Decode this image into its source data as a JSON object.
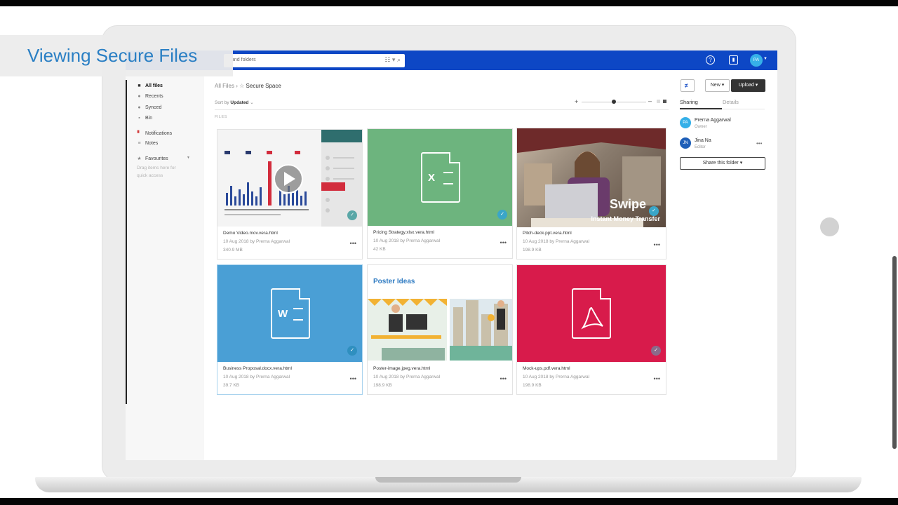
{
  "overlay_title": "Viewing Secure Files",
  "search": {
    "placeholder": "and folders"
  },
  "user_initials": "PA",
  "sidebar": {
    "items": [
      {
        "label": "All files",
        "icon": "folder-icon"
      },
      {
        "label": "Recents",
        "icon": "clock-icon"
      },
      {
        "label": "Synced",
        "icon": "sync-icon"
      },
      {
        "label": "Bin",
        "icon": "bin-icon"
      },
      {
        "label": "Notifications",
        "icon": "bell-icon"
      },
      {
        "label": "Notes",
        "icon": "notes-icon"
      },
      {
        "label": "Favourites",
        "icon": "star-icon"
      }
    ],
    "favourites_hint_1": "Drag items here for",
    "favourites_hint_2": "quick access"
  },
  "breadcrumb": {
    "root": "All Files",
    "current": "Secure Space"
  },
  "sort": {
    "label": "Sort by",
    "value": "Updated"
  },
  "files_label": "FILES",
  "toolbar": {
    "new_label": "New",
    "upload_label": "Upload"
  },
  "files": [
    {
      "name": "Demo Video.mov.vera.html",
      "meta": "10 Aug 2018 by Prerna Aggarwal",
      "size": "340.9 MB"
    },
    {
      "name": "Pricing Strategy.xlsx.vera.html",
      "meta": "10 Aug 2018 by Prerna Aggarwal",
      "size": "42 KB"
    },
    {
      "name": "Pitch-deck.ppt.vera.html",
      "meta": "10 Aug 2018 by Prerna Aggarwal",
      "size": "198.9 KB"
    },
    {
      "name": "Business Proposal.docx.vera.html",
      "meta": "10 Aug 2018 by Prerna Aggarwal",
      "size": "39.7 KB"
    },
    {
      "name": "Poster-image.jpeg.vera.html",
      "meta": "10 Aug 2018 by Prerna Aggarwal",
      "size": "198.9 KB"
    },
    {
      "name": "Mock-ups.pdf.vera.html",
      "meta": "10 Aug 2018 by Prerna Aggarwal",
      "size": "198.9 KB"
    }
  ],
  "thumb_text": {
    "excel_letter": "X",
    "word_letter": "W",
    "swipe_title": "Swipe",
    "swipe_sub": "Instant Money Transfer",
    "poster_title": "Poster Ideas"
  },
  "right_panel": {
    "tabs": [
      "Sharing",
      "Details"
    ],
    "users": [
      {
        "initials": "PA",
        "name": "Prerna Aggarwal",
        "role": "Owner",
        "color": "#36b0e8"
      },
      {
        "initials": "JN",
        "name": "Jina Na",
        "role": "Editor",
        "color": "#1f5fb8"
      }
    ],
    "share_button": "Share this folder"
  },
  "colors": {
    "topbar": "#0d47c5",
    "excel": "#6db47e",
    "word": "#4a9fd5",
    "pdf": "#d81b4b",
    "accent": "#2a7fc4"
  }
}
